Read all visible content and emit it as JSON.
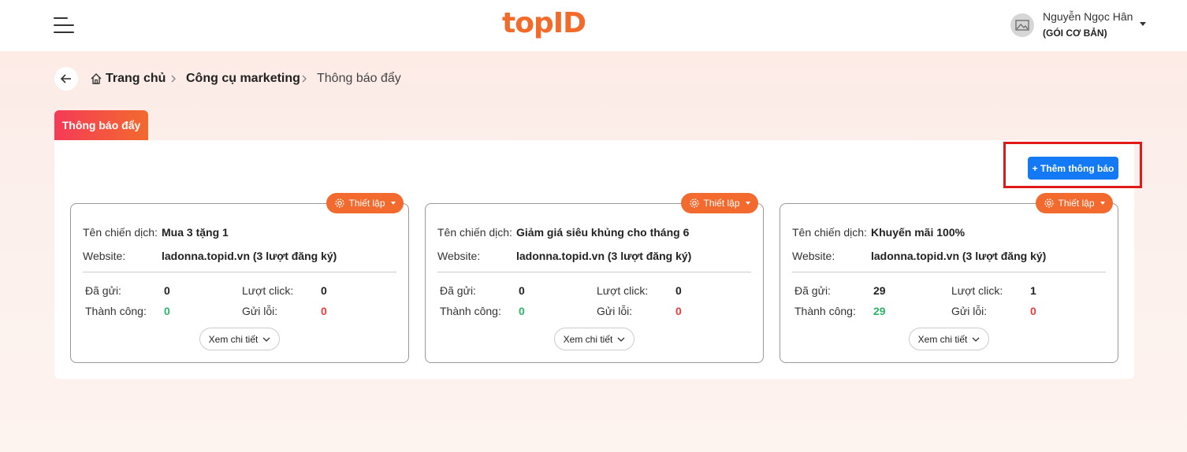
{
  "header": {
    "logo_text": "topID",
    "brand_color": "#f26b2a",
    "user_name": "Nguyễn Ngọc Hân",
    "user_plan": "(GÓI CƠ BẢN)"
  },
  "breadcrumb": {
    "home": "Trang chủ",
    "marketing": "Công cụ marketing",
    "current": "Thông báo đẩy"
  },
  "tab": {
    "label": "Thông báo đẩy"
  },
  "toolbar": {
    "add_label": "+ Thêm thông báo",
    "add_color": "#1479f4"
  },
  "labels": {
    "campaign": "Tên chiến dịch:",
    "website": "Website:",
    "sent": "Đã gửi:",
    "clicks": "Lượt click:",
    "success": "Thành công:",
    "errors": "Gửi lỗi:",
    "setup": "Thiết lập",
    "details": "Xem chi tiết"
  },
  "campaigns": [
    {
      "name": "Mua 3 tặng 1",
      "website": "ladonna.topid.vn (3 lượt đăng ký)",
      "sent": "0",
      "clicks": "0",
      "success": "0",
      "errors": "0"
    },
    {
      "name": "Giảm giá siêu khủng cho tháng 6",
      "website": "ladonna.topid.vn (3 lượt đăng ký)",
      "sent": "0",
      "clicks": "0",
      "success": "0",
      "errors": "0"
    },
    {
      "name": "Khuyến mãi 100%",
      "website": "ladonna.topid.vn (3 lượt đăng ký)",
      "sent": "29",
      "clicks": "1",
      "success": "29",
      "errors": "0"
    }
  ],
  "colors": {
    "success": "#2ab866",
    "error": "#ee3a3a",
    "accent": "#f26a2e"
  }
}
